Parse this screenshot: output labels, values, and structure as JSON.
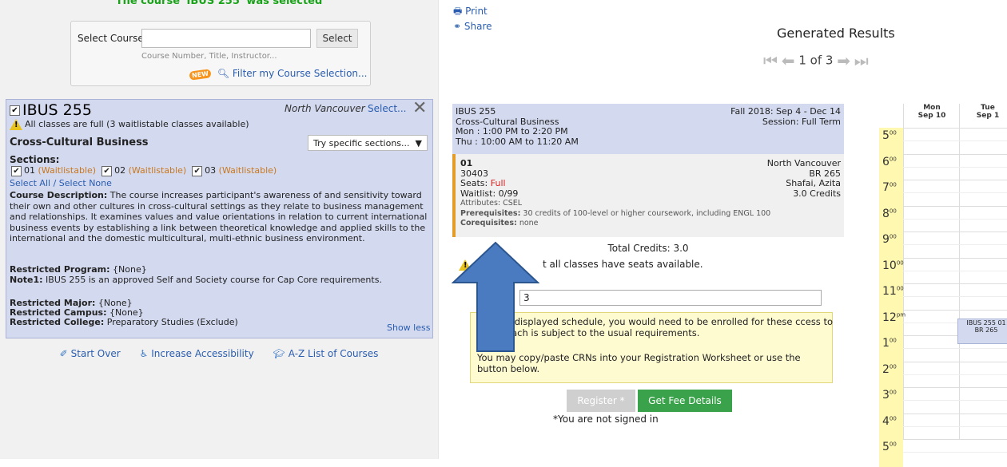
{
  "left": {
    "selected_msg": "The course 'IBUS 255' was selected",
    "select_course_label": "Select Course",
    "course_input_value": "",
    "select_button": "Select",
    "hint": "Course Number, Title, Instructor...",
    "new_badge": "NEW",
    "filter_link": "Filter my Course Selection..."
  },
  "card": {
    "code": "IBUS 255",
    "campus": "North Vancouver",
    "select_link": "Select...",
    "close": "✕",
    "warning": "All classes are full (3 waitlistable classes available)",
    "title": "Cross-Cultural Business",
    "try_sections": "Try specific sections...",
    "sections_label": "Sections:",
    "sections": [
      {
        "num": "01",
        "status": "(Waitlistable)"
      },
      {
        "num": "02",
        "status": "(Waitlistable)"
      },
      {
        "num": "03",
        "status": "(Waitlistable)"
      }
    ],
    "select_all": "Select All / Select None",
    "desc_label": "Course Description:",
    "desc_text": "The course increases participant's awareness of and sensitivity toward their own and other cultures in cross-cultural settings as they relate to business management and relationships. It examines values and value orientations in relation to current international business events by establishing a link between theoretical knowledge and applied skills to the international and the domestic multicultural, multi-ethnic business environment.",
    "restricted_program_label": "Restricted Program:",
    "restricted_program": "{None}",
    "note1_label": "Note1:",
    "note1": "IBUS 255 is an approved Self and Society course for Cap Core requirements.",
    "restricted_major_label": "Restricted Major:",
    "restricted_major": "{None}",
    "restricted_campus_label": "Restricted Campus:",
    "restricted_campus": "{None}",
    "restricted_college_label": "Restricted College:",
    "restricted_college": "Preparatory Studies (Exclude)",
    "show_less": "Show less"
  },
  "bottom_links": {
    "start_over": "Start Over",
    "accessibility": "Increase Accessibility",
    "az_list": "A-Z List of Courses"
  },
  "right": {
    "print": "Print",
    "share": "Share",
    "generated_results": "Generated Results",
    "pager": "1 of 3"
  },
  "schedule": {
    "code": "IBUS 255",
    "title": "Cross-Cultural Business",
    "time1": "Mon : 1:00 PM to 2:20 PM",
    "time2": "Thu : 10:00 AM to 11:20 AM",
    "term": "Fall 2018: Sep 4 - Dec 14",
    "session": "Session: Full Term",
    "section_num": "01",
    "crn": "30403",
    "seats_label": "Seats:",
    "seats": "Full",
    "waitlist": "Waitlist: 0/99",
    "attributes": "Attributes: CSEL",
    "prereq_label": "Prerequisites:",
    "prereq": "30 credits of 100-level or higher coursework, including ENGL 100",
    "coreq_label": "Corequisites:",
    "coreq": "none",
    "campus": "North Vancouver",
    "room": "BR 265",
    "instructor": "Shafai, Azita",
    "credits": "3.0 Credits",
    "total_credits": "Total Credits: 3.0",
    "warn_partial": "t all classes have seats available.",
    "crn_value": "3",
    "note1": "e displayed schedule, you would need to be enrolled for these ccess to each is subject to the usual requirements.",
    "note2": "You may copy/paste CRNs into your Registration Worksheet or use the button below.",
    "register": "Register *",
    "fee": "Get Fee Details",
    "not_signed": "*You are not signed in"
  },
  "calendar": {
    "days": [
      {
        "dow": "Mon",
        "date": "Sep 10"
      },
      {
        "dow": "Tue",
        "date": "Sep 1"
      }
    ],
    "hours": [
      {
        "h": "5",
        "s": "00"
      },
      {
        "h": "6",
        "s": "00"
      },
      {
        "h": "7",
        "s": "00"
      },
      {
        "h": "8",
        "s": "00"
      },
      {
        "h": "9",
        "s": "00"
      },
      {
        "h": "10",
        "s": "00"
      },
      {
        "h": "11",
        "s": "00"
      },
      {
        "h": "12",
        "s": "pm"
      },
      {
        "h": "1",
        "s": "00"
      },
      {
        "h": "2",
        "s": "00"
      },
      {
        "h": "3",
        "s": "00"
      },
      {
        "h": "4",
        "s": "00"
      },
      {
        "h": "5",
        "s": "00"
      }
    ],
    "event_line1": "IBUS 255 01",
    "event_line2": "BR 265"
  },
  "colors": {
    "accent_blue": "#2a5db0",
    "card_bg": "#d3d9ef",
    "waitlist_orange": "#c9781e",
    "fee_green": "#3aa24a",
    "arrow_blue": "#4a7bc0"
  }
}
